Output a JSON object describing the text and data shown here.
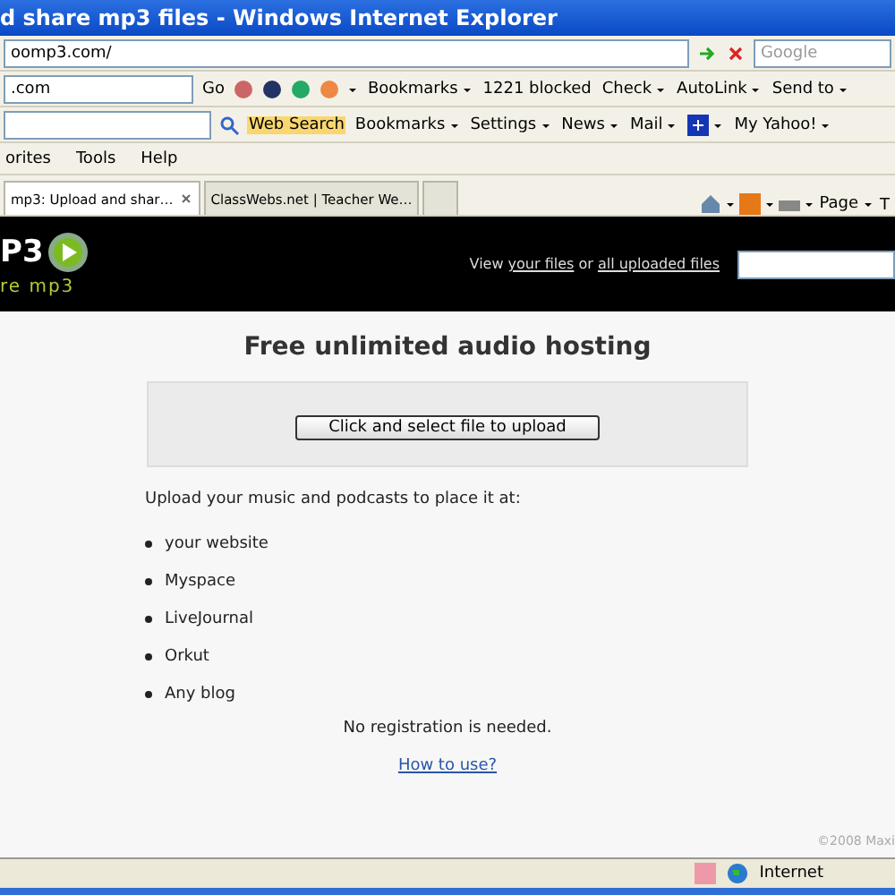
{
  "window": {
    "title": "d share mp3 files - Windows Internet Explorer"
  },
  "address_bar": {
    "value": "oomp3.com/",
    "search_placeholder": "Google"
  },
  "toolbar_1": {
    "field_value": ".com",
    "go": "Go",
    "items": [
      {
        "label": "Bookmarks",
        "menu": true
      },
      {
        "label": "1221 blocked",
        "menu": false
      },
      {
        "label": "Check",
        "menu": true
      },
      {
        "label": "AutoLink",
        "menu": true
      },
      {
        "label": "Send to",
        "menu": true
      }
    ]
  },
  "toolbar_2": {
    "search": "Web Search",
    "items": [
      {
        "label": "Bookmarks",
        "menu": true
      },
      {
        "label": "Settings",
        "menu": true
      },
      {
        "label": "News",
        "menu": true
      },
      {
        "label": "Mail",
        "menu": true
      },
      {
        "kind": "icon",
        "menu": true
      },
      {
        "label": "My Yahoo!",
        "menu": true
      }
    ]
  },
  "menu": [
    "orites",
    "Tools",
    "Help"
  ],
  "tabs": [
    {
      "label": "mp3: Upload and shar…",
      "selected": true
    },
    {
      "label": "ClassWebs.net | Teacher We…",
      "selected": false
    }
  ],
  "command_bar": {
    "page": "Page",
    "tools": "T"
  },
  "site": {
    "logo": "P3",
    "tagline": "re mp3",
    "nav_prefix": "View",
    "nav_link_1": "your files",
    "nav_or": "or",
    "nav_link_2": "all uploaded files"
  },
  "content": {
    "heading": "Free unlimited audio hosting",
    "upload_button": "Click and select file to upload",
    "intro": "Upload your music and podcasts to place it at:",
    "list": [
      "your website",
      "Myspace",
      "LiveJournal",
      "Orkut",
      "Any blog"
    ],
    "note": "No registration is needed.",
    "help_link": "How to use?",
    "copyright": "©2008 Maxi"
  },
  "status_bar": {
    "zone": "Internet"
  }
}
